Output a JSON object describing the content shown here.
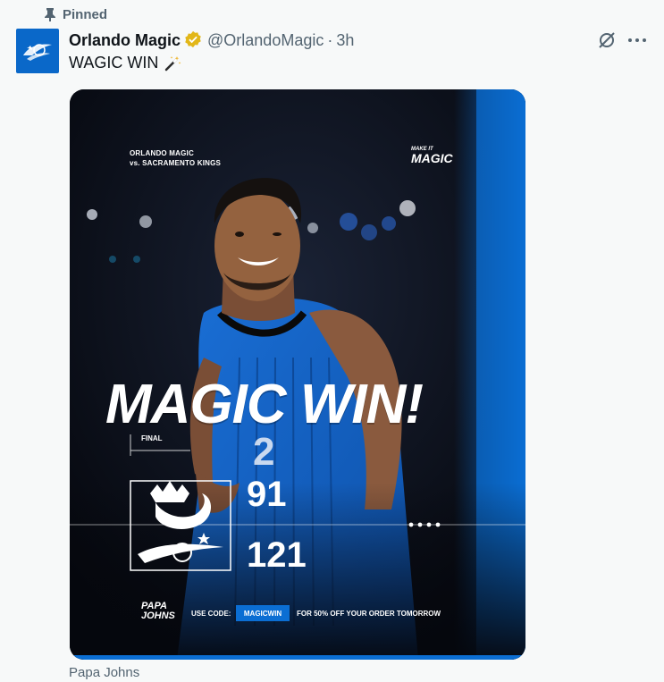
{
  "pinned_label": "Pinned",
  "author": {
    "display_name": "Orlando Magic",
    "handle": "@OrlandoMagic",
    "separator": "·",
    "time": "3h"
  },
  "tweet_text": "WAGIC WIN",
  "icons": {
    "pin": "pin-icon",
    "verified": "verified-badge-icon",
    "grok": "grok-icon",
    "more": "more-options-icon",
    "wand": "magic-wand-emoji"
  },
  "media": {
    "game_title_line1": "ORLANDO MAGIC",
    "game_title_line2": "vs. SACRAMENTO KINGS",
    "brand_tag_small": "MAKE IT",
    "brand_tag": "MAGIC",
    "headline": "MAGIC WIN!",
    "final_label": "FINAL",
    "away_score": "91",
    "home_score": "121",
    "sponsor_line1": "PAPA",
    "sponsor_line2": "JOHNS",
    "promo_label": "USE CODE:",
    "promo_code": "MAGICWIN",
    "promo_desc": "FOR 50% OFF YOUR ORDER TOMORROW"
  },
  "caption": "Papa Johns",
  "colors": {
    "magic_blue": "#0b6ed3",
    "verified_gold": "#e2b719",
    "muted_text": "#536471"
  }
}
